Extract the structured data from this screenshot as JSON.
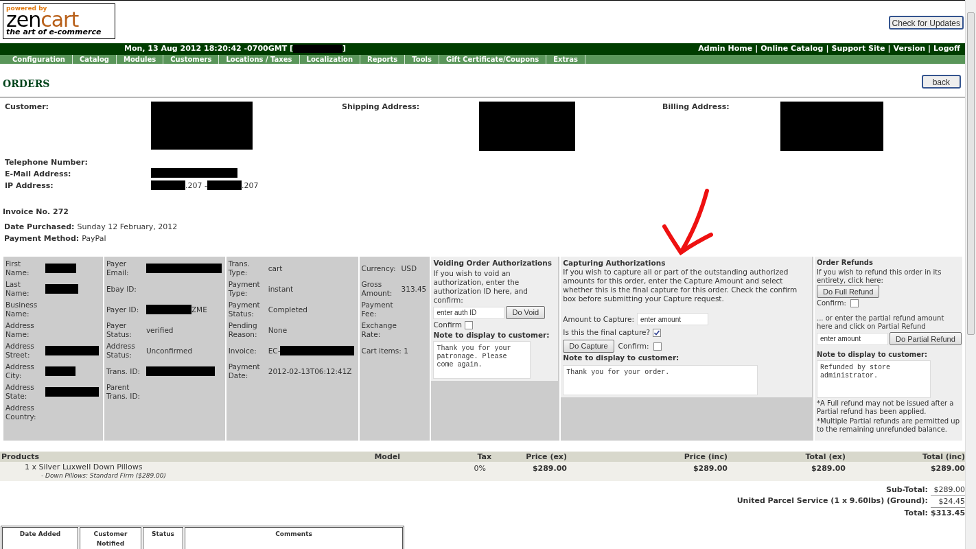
{
  "header": {
    "logo_top": "powered by",
    "logo_left": "zen",
    "logo_right": "cart",
    "logo_tagline": "the art of e-commerce",
    "update_button": "Check for Updates"
  },
  "top_bar": {
    "datetime": "Mon, 13 Aug 2012 18:20:42 -0700GMT [",
    "datetime_end": "]",
    "separator": "|",
    "links": [
      "Admin Home",
      "Online Catalog",
      "Support Site",
      "Version",
      "Logoff"
    ]
  },
  "menu": [
    "Configuration",
    "Catalog",
    "Modules",
    "Customers",
    "Locations / Taxes",
    "Localization",
    "Reports",
    "Tools",
    "Gift Certificate/Coupons",
    "Extras"
  ],
  "page": {
    "title": "ORDERS",
    "back_button": "back"
  },
  "addresses": [
    {
      "label": "Customer:"
    },
    {
      "label": "Shipping Address:"
    },
    {
      "label": "Billing Address:"
    }
  ],
  "contact": [
    {
      "label": "Telephone Number:"
    },
    {
      "label": "E-Mail Address:",
      "parts": [
        {
          "kind": "redacted"
        }
      ]
    },
    {
      "label": "IP Address:",
      "parts": [
        {
          "kind": "redacted"
        },
        {
          "kind": "text",
          "text": ".207 -"
        },
        {
          "kind": "redacted"
        },
        {
          "kind": "text",
          "text": ".207"
        }
      ]
    }
  ],
  "invoice": "Invoice No. 272",
  "order_info": [
    {
      "label": "Date Purchased:",
      "value": "Sunday 12 February, 2012"
    },
    {
      "label": "Payment Method:",
      "value": "PayPal"
    }
  ],
  "paypal_columns": [
    {
      "rows": [
        {
          "label": "First Name:",
          "parts": [
            {
              "kind": "redacted"
            }
          ]
        },
        {
          "label": "Last Name:",
          "parts": [
            {
              "kind": "redacted"
            }
          ]
        },
        {
          "label": "Business Name:",
          "parts": []
        },
        {
          "label": "Address Name:",
          "parts": []
        },
        {
          "label": "Address Street:",
          "parts": [
            {
              "kind": "redacted"
            }
          ]
        },
        {
          "label": "Address City:",
          "parts": [
            {
              "kind": "redacted"
            }
          ]
        },
        {
          "label": "Address State:",
          "parts": [
            {
              "kind": "redacted"
            }
          ]
        },
        {
          "label": "Address Country:",
          "parts": []
        }
      ]
    },
    {
      "rows": [
        {
          "label": "Payer Email:",
          "parts": [
            {
              "kind": "redacted"
            }
          ]
        },
        {
          "label": "Ebay ID:",
          "parts": []
        },
        {
          "label": "Payer ID:",
          "parts": [
            {
              "kind": "redacted"
            },
            {
              "kind": "text",
              "text": "ZME"
            }
          ]
        },
        {
          "label": "Payer Status:",
          "parts": [
            {
              "kind": "text",
              "text": "verified"
            }
          ]
        },
        {
          "label": "Address Status:",
          "parts": [
            {
              "kind": "text",
              "text": "Unconfirmed"
            }
          ]
        },
        {
          "label": "Trans. ID:",
          "parts": [
            {
              "kind": "redacted"
            }
          ]
        },
        {
          "label": "Parent Trans. ID:",
          "parts": []
        }
      ]
    },
    {
      "rows": [
        {
          "label": "Trans. Type:",
          "parts": [
            {
              "kind": "text",
              "text": "cart"
            }
          ]
        },
        {
          "label": "Payment Type:",
          "parts": [
            {
              "kind": "text",
              "text": "instant"
            }
          ]
        },
        {
          "label": "Payment Status:",
          "parts": [
            {
              "kind": "text",
              "text": "Completed"
            }
          ]
        },
        {
          "label": "Pending Reason:",
          "parts": [
            {
              "kind": "text",
              "text": "None"
            }
          ]
        },
        {
          "label": "Invoice:",
          "parts": [
            {
              "kind": "text",
              "text": "EC-"
            },
            {
              "kind": "redacted"
            }
          ]
        },
        {
          "label": "Payment Date:",
          "parts": [
            {
              "kind": "text",
              "text": "2012-02-13T06:12:41Z"
            }
          ]
        }
      ]
    },
    {
      "rows": [
        {
          "label": "Currency:",
          "parts": [
            {
              "kind": "text",
              "text": "USD"
            }
          ]
        },
        {
          "label": "Gross Amount:",
          "parts": [
            {
              "kind": "text",
              "text": "313.45"
            }
          ]
        },
        {
          "label": "Payment Fee:",
          "parts": []
        },
        {
          "label": "Exchange Rate:",
          "parts": []
        },
        {
          "label": "Cart items: 1",
          "parts": []
        }
      ]
    }
  ],
  "voiding": {
    "title": "Voiding Order Authorizations",
    "text": "If you wish to void an authorization, enter the authorization ID here, and confirm:",
    "input": "enter auth ID",
    "button": "Do Void",
    "confirm_label": "Confirm",
    "confirm_checked": false,
    "note_label": "Note to display to customer:",
    "note": "Thank you for your patronage. Please come again."
  },
  "capturing": {
    "title": "Capturing Authorizations",
    "text": "If you wish to capture all or part of the outstanding authorized amounts for this order, enter the Capture Amount and select whether this is the final capture for this order. Check the confirm box before submitting your Capture request.",
    "amount_label": "Amount to Capture:",
    "amount_input": "enter amount",
    "final_label": "Is this the final capture?",
    "final_checked": true,
    "button": "Do Capture",
    "confirm_label": "Confirm:",
    "confirm_checked": false,
    "note_label": "Note to display to customer:",
    "note": "Thank you for your order."
  },
  "refunds": {
    "title": "Order Refunds",
    "text": "If you wish to refund this order in its entirety, click here:",
    "full_button": "Do Full Refund",
    "confirm_label": "Confirm:",
    "confirm_checked": false,
    "partial_text": "... or enter the partial refund amount here and click on Partial Refund",
    "partial_input": "enter amount",
    "partial_button": "Do Partial Refund",
    "note_label": "Note to display to customer:",
    "note": "Refunded by store administrator.",
    "footnotes": [
      "*A Full refund may not be issued after a Partial refund has been applied.",
      "*Multiple Partial refunds are permitted up to the remaining unrefunded balance."
    ]
  },
  "products": {
    "columns": [
      "Products",
      "Model",
      "Tax",
      "Price (ex)",
      "Price (inc)",
      "Total (ex)",
      "Total (inc)"
    ],
    "rows": [
      {
        "name": "1 x Silver Luxwell Down Pillows",
        "attribute": "- Down Pillows: Standard Firm ($289.00)",
        "model": "",
        "tax": "0%",
        "price_ex": "$289.00",
        "price_inc": "$289.00",
        "total_ex": "$289.00",
        "total_inc": "$289.00"
      }
    ]
  },
  "totals": [
    {
      "label": "Sub-Total:",
      "value": "$289.00",
      "kind": "plain"
    },
    {
      "label": "United Parcel Service (1 x 9.60lbs) (Ground):",
      "value": "$24.45",
      "kind": "underlined"
    },
    {
      "label": "Total:",
      "value": "$313.45",
      "kind": "bold"
    }
  ],
  "history": {
    "columns": [
      "Date Added",
      "Customer Notified",
      "Status",
      "Comments"
    ]
  }
}
